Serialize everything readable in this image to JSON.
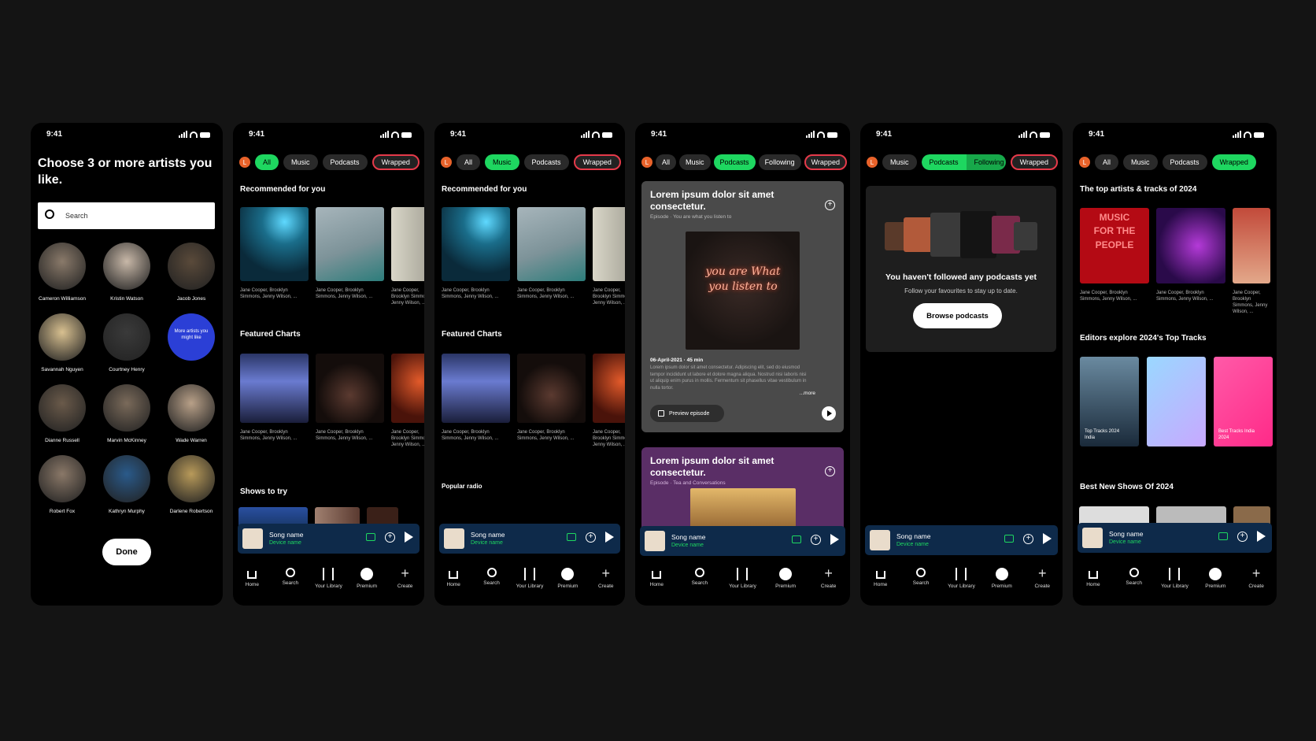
{
  "status_time": "9:41",
  "nav": {
    "home": "Home",
    "search": "Search",
    "library": "Your Library",
    "premium": "Premium",
    "create": "Create"
  },
  "user_initial": "L",
  "player": {
    "song": "Song name",
    "device": "Device name"
  },
  "chips": {
    "all": "All",
    "music": "Music",
    "podcasts": "Podcasts",
    "wrapped": "Wrapped",
    "following": "Following"
  },
  "caption": "Jane Cooper, Brooklyn Simmons, Jenny Wilson, ...",
  "onboarding": {
    "title": "Choose 3 or more artists you like.",
    "search_placeholder": "Search",
    "artists": [
      "Cameron Williamson",
      "Kristin Watson",
      "Jacob Jones",
      "Savannah Nguyen",
      "Courtney Henry",
      "More artists you might like",
      "Dianne Russell",
      "Marvin McKinney",
      "Wade Warren",
      "Robert Fox",
      "Kathryn Murphy",
      "Darlene Robertson"
    ],
    "done": "Done"
  },
  "home": {
    "recommended": "Recommended for you",
    "featured": "Featured Charts",
    "shows": "Shows to try",
    "radio": "Popular radio"
  },
  "podcast_feed": {
    "card1_title": "Lorem ipsum dolor sit amet consectetur.",
    "card1_sub": "Episode · You are what you listen to",
    "card1_art_text": "you are What you listen to",
    "card1_meta": "06-April-2021 · 45 min",
    "card1_desc": "Lorem ipsum dolor sit amet consectetur. Adipiscing elit, sed do eiusmod tempor incididunt ut labore et dolore magna aliqua. Nostrud nisi laboris nisi ut aliquip enim purus in mollis. Fermentum sit phasellus vitae vestibulum in nulla tortor.",
    "more": "...more",
    "preview": "Preview episode",
    "card2_title": "Lorem ipsum dolor sit amet consectetur.",
    "card2_sub": "Episode · Tea and Conversations"
  },
  "following_empty": {
    "title": "You haven't followed any podcasts yet",
    "sub": "Follow your favourites to stay up to date.",
    "button": "Browse podcasts"
  },
  "wrapped": {
    "top": "The top artists & tracks of 2024",
    "art1_text": "MUSIC FOR THE PEOPLE",
    "editors": "Editors explore 2024's Top Tracks",
    "editor_caps": [
      "Top Tracks 2024 India",
      "",
      "Best Tracks India 2024"
    ],
    "best_shows": "Best New Shows Of 2024"
  },
  "colors": {
    "accent": "#1ed760",
    "wrapped_border": "#e63a4a",
    "more_artists": "#2b3fd6",
    "player_bg": "#0e2a4a"
  }
}
